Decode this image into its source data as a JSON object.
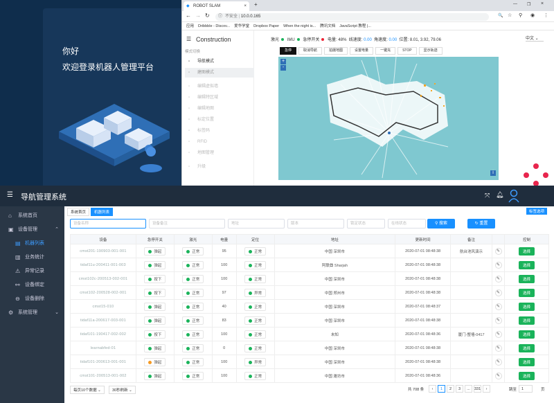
{
  "login": {
    "greeting": "你好",
    "welcome": "欢迎登录机器人管理平台"
  },
  "browser": {
    "tab_title": "ROBOT SLAM",
    "new_tab": "+",
    "security": "不安全",
    "url": "10.0.0.165",
    "bookmarks": [
      "应用",
      "Dribbble - Discov...",
      "爱华学堂",
      "Dropbox Paper",
      "When the night is...",
      "腾讯文档",
      "JavaScript 教程 |..."
    ]
  },
  "slam": {
    "title": "Construction",
    "side_section": "模式切换",
    "side_items": [
      "导航模式",
      "建图模式",
      "编辑虚拟墙",
      "编辑特区域",
      "编辑地图",
      "标定位置",
      "标签码",
      "RFID",
      "地图管理",
      "升级"
    ],
    "status": {
      "lidar_label": "激光",
      "imu_label": "IMU",
      "estop_label": "急停开关",
      "battery_label": "电量",
      "battery": "48%",
      "lin_label": "线速度",
      "lin": "0.00",
      "ang_label": "角速度",
      "ang": "0.00",
      "pos_label": "位置",
      "pos": "8.01, 3.92, 79.06"
    },
    "lang": "中文",
    "controls": [
      "急停",
      "取消导航",
      "拍摄地图",
      "设置电量",
      "一键充",
      "STOP",
      "显示轨迹"
    ],
    "zoom_in": "+",
    "zoom_out": "-",
    "map_info": "i"
  },
  "app": {
    "title": "导航管理系统",
    "nav": [
      {
        "label": "系统首页",
        "icon": "home-icon"
      },
      {
        "label": "设备管理",
        "icon": "device-icon"
      },
      {
        "label": "机器列表",
        "icon": "robot-icon",
        "sub": true,
        "active": true
      },
      {
        "label": "业务统计",
        "icon": "chart-icon",
        "sub": true
      },
      {
        "label": "异常记录",
        "icon": "alert-icon",
        "sub": true
      },
      {
        "label": "设备绑定",
        "icon": "link-icon",
        "sub": true
      },
      {
        "label": "设备删除",
        "icon": "delete-icon",
        "sub": true
      },
      {
        "label": "系统管理",
        "icon": "settings-icon"
      }
    ],
    "crumbs": [
      "系统首页",
      "机器列表"
    ],
    "tag_btn": "标签选项",
    "filters": {
      "device_name": "设备名称",
      "device_note": "设备备注",
      "address": "地址",
      "version": "版本",
      "lock_state": "锁定状态",
      "online_state": "在线状态",
      "search": "搜索",
      "reset": "重置"
    },
    "columns": [
      "设备",
      "急停开关",
      "激光",
      "电量",
      "定位",
      "地址",
      "更新时间",
      "备注",
      "",
      "控制"
    ],
    "rows": [
      {
        "dev": "cmst201-190903-001-001",
        "es": "弹起",
        "esc": "#1ab35a",
        "lidar": "正常",
        "bat": "95",
        "loc": "正常",
        "addr": "中国 深圳市",
        "time": "2020-07-01 08:48:38",
        "note": "航台池风演示",
        "op": "选择"
      },
      {
        "dev": "tidaf11u-200411-001-003",
        "es": "弹起",
        "esc": "#1ab35a",
        "lidar": "正常",
        "bat": "100",
        "loc": "正常",
        "addr": "阿联酋 Sharjah",
        "time": "2020-07-01 08:48:38",
        "note": "",
        "op": "选择"
      },
      {
        "dev": "cmst102c-200513-002-001",
        "es": "按下",
        "esc": "#1ab35a",
        "lidar": "正常",
        "bat": "100",
        "loc": "正常",
        "addr": "中国 深圳市",
        "time": "2020-07-01 08:48:38",
        "note": "",
        "op": "选择"
      },
      {
        "dev": "cmst102-200528-002-001",
        "es": "按下",
        "esc": "#1ab35a",
        "lidar": "正常",
        "bat": "97",
        "loc": "异常",
        "addr": "中国 郑州市",
        "time": "2020-07-01 08:48:38",
        "note": "",
        "op": "选择"
      },
      {
        "dev": "cmst15-010",
        "es": "弹起",
        "esc": "#1ab35a",
        "lidar": "正常",
        "bat": "40",
        "loc": "正常",
        "addr": "中国 深圳市",
        "time": "2020-07-01 08:48:37",
        "note": "",
        "op": "选择"
      },
      {
        "dev": "tidaf11a-200617-003-001",
        "es": "弹起",
        "esc": "#1ab35a",
        "lidar": "正常",
        "bat": "83",
        "loc": "正常",
        "addr": "中国 深圳市",
        "time": "2020-07-01 08:48:38",
        "note": "",
        "op": "选择"
      },
      {
        "dev": "tidaf101-190417-002-002",
        "es": "按下",
        "esc": "#1ab35a",
        "lidar": "正常",
        "bat": "100",
        "loc": "正常",
        "addr": "未知",
        "time": "2020-07-01 08:48:36",
        "note": "厦门-整墙-0417",
        "op": "选择"
      },
      {
        "dev": "learnabfed-01",
        "es": "弹起",
        "esc": "#1ab35a",
        "lidar": "正常",
        "bat": "0",
        "loc": "正常",
        "addr": "中国 深圳市",
        "time": "2020-07-01 08:48:38",
        "note": "",
        "op": "选择"
      },
      {
        "dev": "tidaf101-200613-001-001",
        "es": "弹起",
        "esc": "#f59a23",
        "lidar": "正常",
        "bat": "100",
        "loc": "异常",
        "addr": "中国 深圳市",
        "time": "2020-07-01 08:48:38",
        "note": "",
        "op": "选择"
      },
      {
        "dev": "cmst101-200513-001-002",
        "es": "弹起",
        "esc": "#1ab35a",
        "lidar": "正常",
        "bat": "100",
        "loc": "正常",
        "addr": "中国 潍坊市",
        "time": "2020-07-01 08:48:36",
        "note": "",
        "op": "选择"
      }
    ],
    "pager": {
      "page_size": "每页10个数据",
      "refresh": "30秒刷新",
      "total": "共 708 条",
      "pages": [
        "1",
        "2",
        "3",
        "...",
        "331"
      ],
      "goto_label": "跳至",
      "goto_value": "1",
      "page_suffix": "页"
    }
  },
  "colors": {
    "navy": "#0f2d4c",
    "header": "#1f2d3d",
    "sidebar": "#2a3746",
    "accent": "#1890ff",
    "green": "#1ab35a",
    "map": "#7fc8d0"
  }
}
